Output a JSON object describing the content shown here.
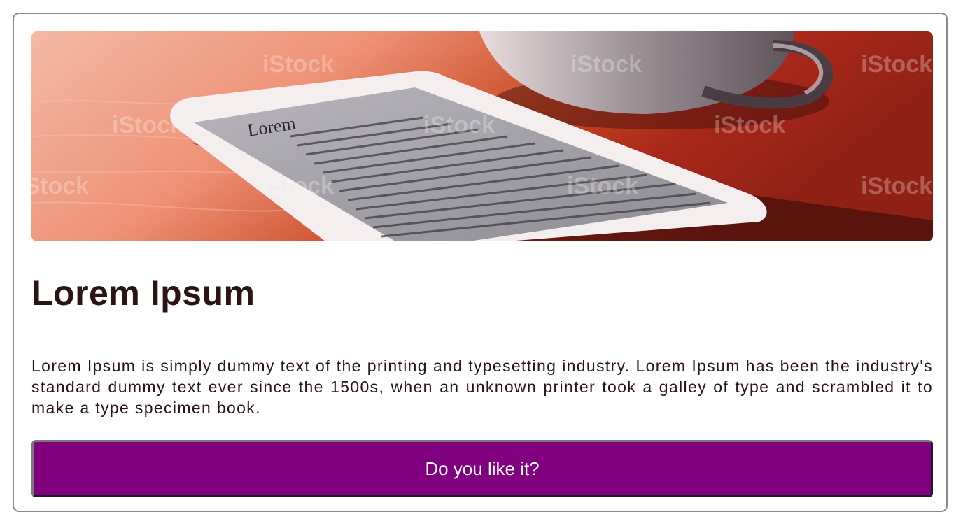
{
  "card": {
    "image_alt": "Smartphone with Lorem text on a table next to a cup",
    "watermark": "iStock",
    "phone_screen_heading": "Lorem",
    "title": "Lorem Ipsum",
    "description": "Lorem Ipsum is simply dummy text of the printing and typesetting industry. Lorem Ipsum has been the industry's standard dummy text ever since the 1500s, when an unknown printer took a galley of type and scrambled it to make a type specimen book.",
    "button_label": "Do you like it?"
  },
  "colors": {
    "button_bg": "#800080",
    "text": "#2a1414",
    "border": "#8a8a8a"
  }
}
